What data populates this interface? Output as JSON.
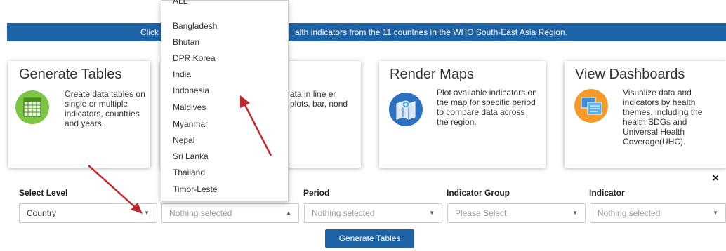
{
  "banner": {
    "text_left": "Click",
    "text_right": "alth indicators from the 11 countries in the WHO South-East Asia Region."
  },
  "cards": [
    {
      "title": "Generate Tables",
      "desc": "Create data tables on single or multiple indicators, countries and years.",
      "icon": "table-grid-icon",
      "color": "#7cc443"
    },
    {
      "title": "",
      "desc": "ata in line er plots, bar, nond",
      "icon": "",
      "color": ""
    },
    {
      "title": "Render Maps",
      "desc": "Plot available indicators on the map for specific period to compare data across the region.",
      "icon": "map-icon",
      "color": "#2d71c1"
    },
    {
      "title": "View Dashboards",
      "desc": "Visualize data and indicators by health themes, including the health SDGs and Universal Health Coverage(UHC).",
      "icon": "dashboard-icon",
      "color": "#f39a2b"
    }
  ],
  "filters": {
    "level": {
      "label": "Select Level",
      "value": "Country"
    },
    "country": {
      "label": "",
      "placeholder": "Nothing selected"
    },
    "period": {
      "label": "Period",
      "placeholder": "Nothing selected"
    },
    "indicator_group": {
      "label": "Indicator Group",
      "placeholder": "Please Select"
    },
    "indicator": {
      "label": "Indicator",
      "placeholder": "Nothing selected"
    }
  },
  "close_label": "×",
  "generate_button": "Generate Tables",
  "dropdown_items": [
    "ALL",
    "Bangladesh",
    "Bhutan",
    "DPR Korea",
    "India",
    "Indonesia",
    "Maldives",
    "Myanmar",
    "Nepal",
    "Sri Lanka",
    "Thailand",
    "Timor-Leste"
  ],
  "annotation_color": "#c0282d"
}
